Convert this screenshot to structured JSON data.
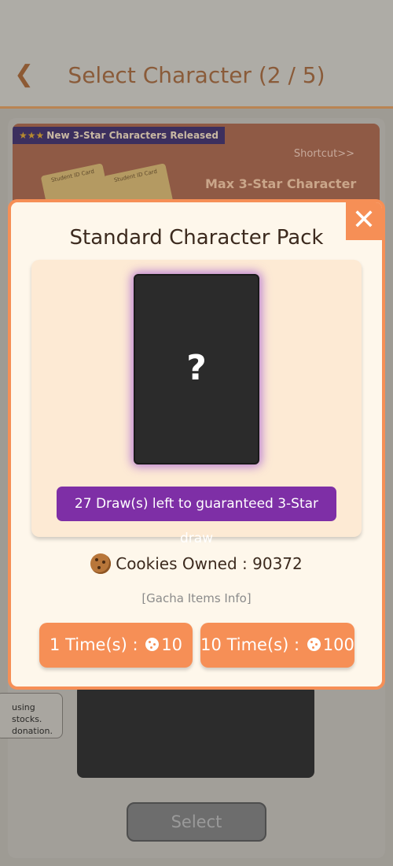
{
  "header": {
    "title": "Select Character (2 / 5)",
    "back_icon": "chevron-left-icon"
  },
  "banner": {
    "tag_stars": "★★★",
    "tag_text": "New 3-Star Characters Released",
    "shortcut": "Shortcut>>",
    "headline": "Max 3-Star Character",
    "card_label": "Student ID Card"
  },
  "background": {
    "notice_text": "using stocks. donation.",
    "select_label": "Select"
  },
  "modal": {
    "close_icon": "close-icon",
    "title": "Standard Character Pack",
    "card_symbol": "?",
    "guarantee_text": "27 Draw(s) left to guaranteed 3-Star draw",
    "cookies_label": "Cookies Owned : 90372",
    "gacha_info": "[Gacha Items Info]",
    "draw_once_prefix": "1 Time(s) :",
    "draw_once_cost": "10",
    "draw_ten_prefix": "10 Time(s) :",
    "draw_ten_cost": "100"
  },
  "colors": {
    "accent": "#f68f56",
    "purple": "#7e2fa6",
    "modal_bg": "#fef7eb"
  }
}
